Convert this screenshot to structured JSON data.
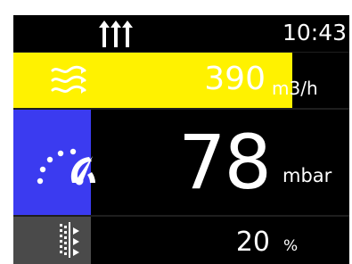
{
  "status_bar": {
    "time": "10:43",
    "icon": "three-arrows-up-icon"
  },
  "flow": {
    "icon": "airflow-waves-icon",
    "value": "390",
    "unit": "m3/h",
    "bar_color": "#fff200",
    "bar_fill_fraction": 0.83
  },
  "pressure": {
    "icon": "speedometer-gauge-icon",
    "value": "78",
    "unit": "mbar",
    "bar_color": "#3b3bf0",
    "bar_fill_fraction": 0.23
  },
  "filter": {
    "icon": "filter-icon",
    "value": "20",
    "unit": "%",
    "bar_color": "#4a4a4a",
    "bar_fill_fraction": 0.23
  }
}
